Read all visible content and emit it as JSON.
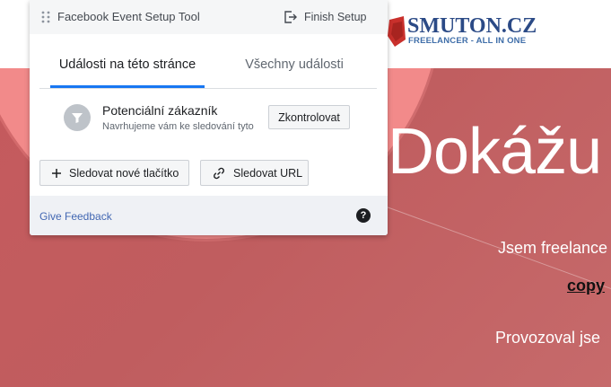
{
  "site": {
    "logo_title": "SMUTON.CZ",
    "logo_subtitle": "FREELANCER - ALL IN ONE",
    "hero_heading": "Dokážu",
    "hero_line1": "Jsem freelance",
    "hero_line2": "copy",
    "hero_line3": "Provozoval jse"
  },
  "panel": {
    "title": "Facebook Event Setup Tool",
    "finish_label": "Finish Setup",
    "tabs": [
      {
        "label": "Události na této stránce",
        "active": true
      },
      {
        "label": "Všechny události",
        "active": false
      }
    ],
    "event": {
      "name": "Potenciální zákazník",
      "description": "Navrhujeme vám ke sledování tyto",
      "check_label": "Zkontrolovat",
      "icon": "filter-icon"
    },
    "actions": {
      "track_button_label": "Sledovat nové tlačítko",
      "track_url_label": "Sledovat URL"
    },
    "footer": {
      "feedback_label": "Give Feedback",
      "help_glyph": "?"
    }
  },
  "colors": {
    "accent": "#1877f2",
    "hero_bg": "#c25b5e",
    "hero_circle": "#f28a8a",
    "logo_blue": "#2b4a86",
    "logo_red": "#c9302c",
    "link": "#4267b2"
  }
}
